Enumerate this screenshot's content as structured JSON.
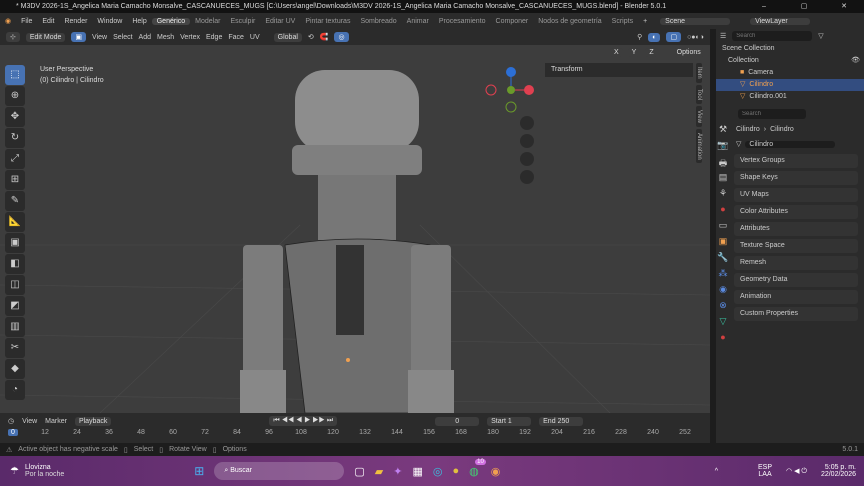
{
  "title": "* M3DV 2026-1S_Angelica Maria Camacho Monsalve_CASCANUECES_MUGS [C:\\Users\\angel\\Downloads\\M3DV 2026-1S_Angelica Maria Camacho Monsalve_CASCANUECES_MUGS.blend] - Blender 5.0.1",
  "window_controls": [
    "–",
    "▢",
    "✕"
  ],
  "menu": [
    "File",
    "Edit",
    "Render",
    "Window",
    "Help"
  ],
  "workspaces": [
    "Genérico",
    "Modelar",
    "Esculpir",
    "Editar UV",
    "Pintar texturas",
    "Sombreado",
    "Animar",
    "Procesamiento",
    "Componer",
    "Nodos de geometría",
    "Scripts"
  ],
  "scene": "Scene",
  "view_layer": "ViewLayer",
  "viewport_header": {
    "mode": "Edit Mode",
    "menus": [
      "View",
      "Select",
      "Add",
      "Mesh",
      "Vertex",
      "Edge",
      "Face",
      "UV"
    ],
    "orientation": "Global",
    "axes": [
      "X",
      "Y",
      "Z"
    ],
    "options": "Options"
  },
  "viewport": {
    "perspective": "User Perspective",
    "object": "(0) Cilindro | Cilindro",
    "transform_panel": "Transform",
    "sidebar_tabs": [
      "Item",
      "Tool",
      "View",
      "Animation"
    ]
  },
  "outliner": {
    "search_placeholder": "Search",
    "items": [
      {
        "label": "Scene Collection"
      },
      {
        "label": "Collection"
      },
      {
        "label": "Camera"
      },
      {
        "label": "Cilindro",
        "selected": true
      },
      {
        "label": "Cilindro.001"
      }
    ]
  },
  "properties": {
    "search_placeholder": "Search",
    "breadcrumb": [
      "Cilindro",
      "Cilindro"
    ],
    "mesh_name": "Cilindro",
    "panels": [
      "Vertex Groups",
      "Shape Keys",
      "UV Maps",
      "Color Attributes",
      "Attributes",
      "Texture Space",
      "Remesh",
      "Geometry Data",
      "Animation",
      "Custom Properties"
    ]
  },
  "timeline": {
    "menus": [
      "View",
      "Marker",
      "Playback"
    ],
    "current_frame": "0",
    "start_label": "Start",
    "start": "1",
    "end_label": "End",
    "end": "250",
    "ticks": [
      "0",
      "12",
      "24",
      "36",
      "48",
      "60",
      "72",
      "84",
      "96",
      "108",
      "120",
      "132",
      "144",
      "156",
      "168",
      "180",
      "192",
      "204",
      "216",
      "228",
      "240",
      "252"
    ]
  },
  "status": {
    "warning": "Active object has negative scale",
    "hints": [
      "Select",
      "Rotate View",
      "Options"
    ],
    "version": "5.0.1"
  },
  "taskbar": {
    "weather": "Llovizna",
    "weather_sub": "Por la noche",
    "search": "Buscar",
    "badge": "10",
    "lang": "ESP",
    "lang_sub": "LAA",
    "time": "5:05 p. m.",
    "date": "22/02/2026"
  },
  "colors": {
    "accent": "#4772b3",
    "selected_object": "#f0a050"
  }
}
